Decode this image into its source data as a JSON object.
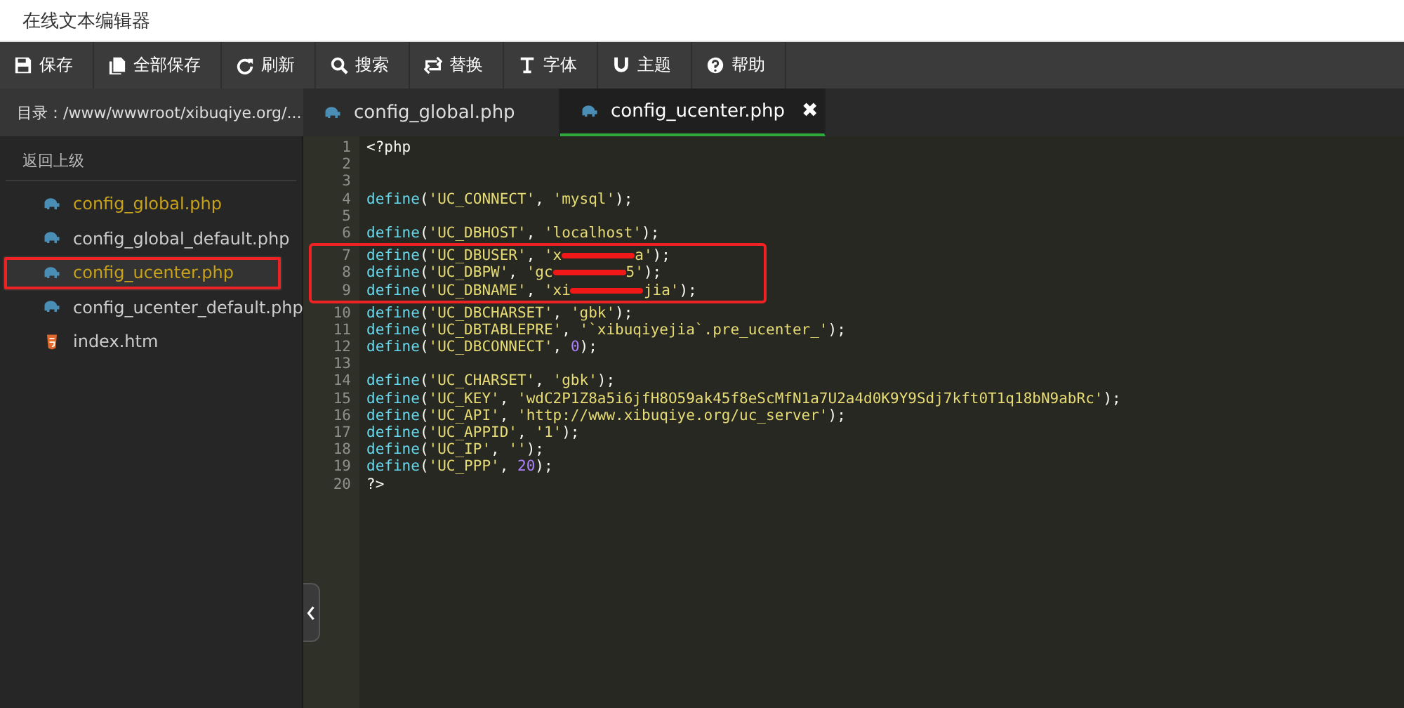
{
  "window": {
    "title": "在线文本编辑器"
  },
  "toolbar": [
    "保存",
    "全部保存",
    "刷新",
    "搜索",
    "替换",
    "字体",
    "主题",
    "帮助"
  ],
  "directory": "目录：/www/wwwroot/xibuqiye.org/...",
  "tabs": [
    {
      "label": "config_global.php",
      "selected": false,
      "closable": false
    },
    {
      "label": "config_ucenter.php",
      "selected": true,
      "closable": true
    }
  ],
  "close_glyph": "✖",
  "sidebar": {
    "back": "返回上级",
    "items": [
      {
        "label": "config_global.php",
        "kind": "php",
        "open": true,
        "selected": false
      },
      {
        "label": "config_global_default.php",
        "kind": "php",
        "open": false,
        "selected": false
      },
      {
        "label": "config_ucenter.php",
        "kind": "php",
        "open": true,
        "selected": true
      },
      {
        "label": "config_ucenter_default.php",
        "kind": "php",
        "open": false,
        "selected": false
      },
      {
        "label": "index.htm",
        "kind": "html",
        "open": false,
        "selected": false
      }
    ]
  },
  "code": [
    {
      "n": "1",
      "boxed": false,
      "tokens": [
        {
          "kind": "plain",
          "text": "<?php"
        }
      ]
    },
    {
      "n": "2",
      "boxed": false
    },
    {
      "n": "3",
      "boxed": false
    },
    {
      "n": "4",
      "boxed": false,
      "tokens": [
        {
          "kind": "fn",
          "text": "define"
        },
        {
          "kind": "plain",
          "text": "("
        },
        {
          "kind": "str",
          "text": "'UC_CONNECT'"
        },
        {
          "kind": "plain",
          "text": ", "
        },
        {
          "kind": "str",
          "text": "'mysql'"
        },
        {
          "kind": "plain",
          "text": ");"
        }
      ]
    },
    {
      "n": "5",
      "boxed": false
    },
    {
      "n": "6",
      "boxed": false,
      "tokens": [
        {
          "kind": "fn",
          "text": "define"
        },
        {
          "kind": "plain",
          "text": "("
        },
        {
          "kind": "str",
          "text": "'UC_DBHOST'"
        },
        {
          "kind": "plain",
          "text": ", "
        },
        {
          "kind": "str",
          "text": "'localhost'"
        },
        {
          "kind": "plain",
          "text": ");"
        }
      ]
    },
    {
      "n": "7",
      "boxed": true,
      "tokens": [
        {
          "kind": "fn",
          "text": "define"
        },
        {
          "kind": "plain",
          "text": "("
        },
        {
          "kind": "str",
          "text": "'UC_DBUSER'"
        },
        {
          "kind": "plain",
          "text": ", "
        },
        {
          "kind": "str",
          "text": "'x"
        },
        {
          "kind": "redacted"
        },
        {
          "kind": "str",
          "text": "a'"
        },
        {
          "kind": "plain",
          "text": ");"
        }
      ]
    },
    {
      "n": "8",
      "boxed": true,
      "tokens": [
        {
          "kind": "fn",
          "text": "define"
        },
        {
          "kind": "plain",
          "text": "("
        },
        {
          "kind": "str",
          "text": "'UC_DBPW'"
        },
        {
          "kind": "plain",
          "text": ", "
        },
        {
          "kind": "str",
          "text": "'gc"
        },
        {
          "kind": "redacted"
        },
        {
          "kind": "str",
          "text": "5'"
        },
        {
          "kind": "plain",
          "text": ");"
        }
      ]
    },
    {
      "n": "9",
      "boxed": true,
      "tokens": [
        {
          "kind": "fn",
          "text": "define"
        },
        {
          "kind": "plain",
          "text": "("
        },
        {
          "kind": "str",
          "text": "'UC_DBNAME'"
        },
        {
          "kind": "plain",
          "text": ", "
        },
        {
          "kind": "str",
          "text": "'xi"
        },
        {
          "kind": "redacted"
        },
        {
          "kind": "str",
          "text": "jia'"
        },
        {
          "kind": "plain",
          "text": ");"
        }
      ]
    },
    {
      "n": "10",
      "boxed": false,
      "tokens": [
        {
          "kind": "fn",
          "text": "define"
        },
        {
          "kind": "plain",
          "text": "("
        },
        {
          "kind": "str",
          "text": "'UC_DBCHARSET'"
        },
        {
          "kind": "plain",
          "text": ", "
        },
        {
          "kind": "str",
          "text": "'gbk'"
        },
        {
          "kind": "plain",
          "text": ");"
        }
      ]
    },
    {
      "n": "11",
      "boxed": false,
      "tokens": [
        {
          "kind": "fn",
          "text": "define"
        },
        {
          "kind": "plain",
          "text": "("
        },
        {
          "kind": "str",
          "text": "'UC_DBTABLEPRE'"
        },
        {
          "kind": "plain",
          "text": ", "
        },
        {
          "kind": "str",
          "text": "'`xibuqiyejia`.pre_ucenter_'"
        },
        {
          "kind": "plain",
          "text": ");"
        }
      ]
    },
    {
      "n": "12",
      "boxed": false,
      "tokens": [
        {
          "kind": "fn",
          "text": "define"
        },
        {
          "kind": "plain",
          "text": "("
        },
        {
          "kind": "str",
          "text": "'UC_DBCONNECT'"
        },
        {
          "kind": "plain",
          "text": ", "
        },
        {
          "kind": "num",
          "text": "0"
        },
        {
          "kind": "plain",
          "text": ");"
        }
      ]
    },
    {
      "n": "13",
      "boxed": false
    },
    {
      "n": "14",
      "boxed": false,
      "tokens": [
        {
          "kind": "fn",
          "text": "define"
        },
        {
          "kind": "plain",
          "text": "("
        },
        {
          "kind": "str",
          "text": "'UC_CHARSET'"
        },
        {
          "kind": "plain",
          "text": ", "
        },
        {
          "kind": "str",
          "text": "'gbk'"
        },
        {
          "kind": "plain",
          "text": ");"
        }
      ]
    },
    {
      "n": "15",
      "boxed": false,
      "tokens": [
        {
          "kind": "fn",
          "text": "define"
        },
        {
          "kind": "plain",
          "text": "("
        },
        {
          "kind": "str",
          "text": "'UC_KEY'"
        },
        {
          "kind": "plain",
          "text": ", "
        },
        {
          "kind": "str",
          "text": "'wdC2P1Z8a5i6jfH8O59ak45f8eScMfN1a7U2a4d0K9Y9Sdj7kft0T1q18bN9abRc'"
        },
        {
          "kind": "plain",
          "text": ");"
        }
      ]
    },
    {
      "n": "16",
      "boxed": false,
      "tokens": [
        {
          "kind": "fn",
          "text": "define"
        },
        {
          "kind": "plain",
          "text": "("
        },
        {
          "kind": "str",
          "text": "'UC_API'"
        },
        {
          "kind": "plain",
          "text": ", "
        },
        {
          "kind": "str",
          "text": "'http://www.xibuqiye.org/uc_server'"
        },
        {
          "kind": "plain",
          "text": ");"
        }
      ]
    },
    {
      "n": "17",
      "boxed": false,
      "tokens": [
        {
          "kind": "fn",
          "text": "define"
        },
        {
          "kind": "plain",
          "text": "("
        },
        {
          "kind": "str",
          "text": "'UC_APPID'"
        },
        {
          "kind": "plain",
          "text": ", "
        },
        {
          "kind": "str",
          "text": "'1'"
        },
        {
          "kind": "plain",
          "text": ");"
        }
      ]
    },
    {
      "n": "18",
      "boxed": false,
      "tokens": [
        {
          "kind": "fn",
          "text": "define"
        },
        {
          "kind": "plain",
          "text": "("
        },
        {
          "kind": "str",
          "text": "'UC_IP'"
        },
        {
          "kind": "plain",
          "text": ", "
        },
        {
          "kind": "str",
          "text": "''"
        },
        {
          "kind": "plain",
          "text": ");"
        }
      ]
    },
    {
      "n": "19",
      "boxed": false,
      "tokens": [
        {
          "kind": "fn",
          "text": "define"
        },
        {
          "kind": "plain",
          "text": "("
        },
        {
          "kind": "str",
          "text": "'UC_PPP'"
        },
        {
          "kind": "plain",
          "text": ", "
        },
        {
          "kind": "num",
          "text": "20"
        },
        {
          "kind": "plain",
          "text": ");"
        }
      ]
    },
    {
      "n": "20",
      "boxed": false,
      "tokens": [
        {
          "kind": "plain",
          "text": "?>"
        }
      ]
    }
  ]
}
